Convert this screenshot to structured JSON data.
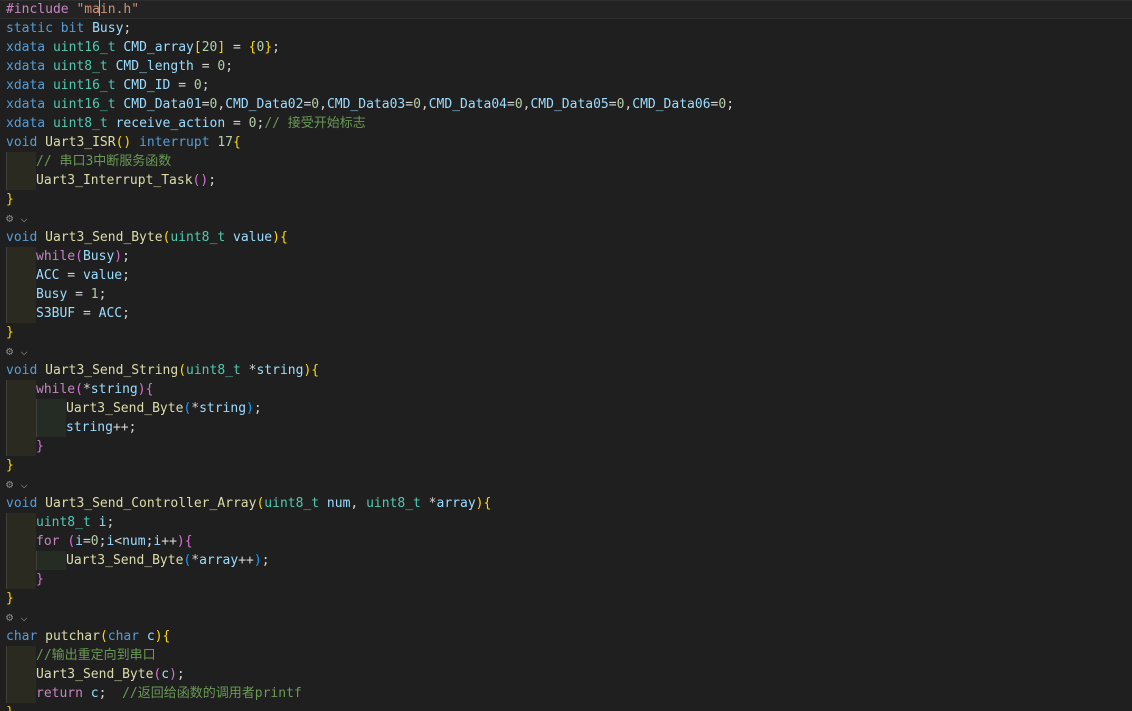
{
  "editor": {
    "codelens_label": "⚙ ⌵",
    "lines": [
      {
        "indent": 0,
        "current": true,
        "tokens": [
          [
            "pp",
            "#include"
          ],
          [
            "pl",
            " "
          ],
          [
            "str",
            "\"ma"
          ],
          [
            "caret",
            ""
          ],
          [
            "str",
            "in.h\""
          ]
        ]
      },
      {
        "indent": 0,
        "tokens": [
          [
            "kw",
            "static"
          ],
          [
            "pl",
            " "
          ],
          [
            "kw",
            "bit"
          ],
          [
            "pl",
            " "
          ],
          [
            "var",
            "Busy"
          ],
          [
            "pl",
            ";"
          ]
        ]
      },
      {
        "indent": 0,
        "tokens": [
          [
            "kw",
            "xdata"
          ],
          [
            "pl",
            " "
          ],
          [
            "ty",
            "uint16_t"
          ],
          [
            "pl",
            " "
          ],
          [
            "var",
            "CMD_array"
          ],
          [
            "b1",
            "["
          ],
          [
            "num",
            "20"
          ],
          [
            "b1",
            "]"
          ],
          [
            "pl",
            " = "
          ],
          [
            "b1",
            "{"
          ],
          [
            "num",
            "0"
          ],
          [
            "b1",
            "}"
          ],
          [
            "pl",
            ";"
          ]
        ]
      },
      {
        "indent": 0,
        "tokens": [
          [
            "kw",
            "xdata"
          ],
          [
            "pl",
            " "
          ],
          [
            "ty",
            "uint8_t"
          ],
          [
            "pl",
            " "
          ],
          [
            "var",
            "CMD_length"
          ],
          [
            "pl",
            " = "
          ],
          [
            "num",
            "0"
          ],
          [
            "pl",
            ";"
          ]
        ]
      },
      {
        "indent": 0,
        "tokens": [
          [
            "kw",
            "xdata"
          ],
          [
            "pl",
            " "
          ],
          [
            "ty",
            "uint16_t"
          ],
          [
            "pl",
            " "
          ],
          [
            "var",
            "CMD_ID"
          ],
          [
            "pl",
            " = "
          ],
          [
            "num",
            "0"
          ],
          [
            "pl",
            ";"
          ]
        ]
      },
      {
        "indent": 0,
        "tokens": [
          [
            "kw",
            "xdata"
          ],
          [
            "pl",
            " "
          ],
          [
            "ty",
            "uint16_t"
          ],
          [
            "pl",
            " "
          ],
          [
            "var",
            "CMD_Data01"
          ],
          [
            "pl",
            "="
          ],
          [
            "num",
            "0"
          ],
          [
            "pl",
            ","
          ],
          [
            "var",
            "CMD_Data02"
          ],
          [
            "pl",
            "="
          ],
          [
            "num",
            "0"
          ],
          [
            "pl",
            ","
          ],
          [
            "var",
            "CMD_Data03"
          ],
          [
            "pl",
            "="
          ],
          [
            "num",
            "0"
          ],
          [
            "pl",
            ","
          ],
          [
            "var",
            "CMD_Data04"
          ],
          [
            "pl",
            "="
          ],
          [
            "num",
            "0"
          ],
          [
            "pl",
            ","
          ],
          [
            "var",
            "CMD_Data05"
          ],
          [
            "pl",
            "="
          ],
          [
            "num",
            "0"
          ],
          [
            "pl",
            ","
          ],
          [
            "var",
            "CMD_Data06"
          ],
          [
            "pl",
            "="
          ],
          [
            "num",
            "0"
          ],
          [
            "pl",
            ";"
          ]
        ]
      },
      {
        "indent": 0,
        "tokens": [
          [
            "kw",
            "xdata"
          ],
          [
            "pl",
            " "
          ],
          [
            "ty",
            "uint8_t"
          ],
          [
            "pl",
            " "
          ],
          [
            "var",
            "receive_action"
          ],
          [
            "pl",
            " = "
          ],
          [
            "num",
            "0"
          ],
          [
            "pl",
            ";"
          ],
          [
            "cm",
            "// 接受开始标志"
          ]
        ]
      },
      {
        "indent": 0,
        "tokens": [
          [
            "kw",
            "void"
          ],
          [
            "pl",
            " "
          ],
          [
            "fn",
            "Uart3_ISR"
          ],
          [
            "b1",
            "()"
          ],
          [
            "pl",
            " "
          ],
          [
            "kw",
            "interrupt"
          ],
          [
            "pl",
            " "
          ],
          [
            "num",
            "17"
          ],
          [
            "b1",
            "{"
          ]
        ]
      },
      {
        "indent": 1,
        "tokens": [
          [
            "cm",
            "// 串口3中断服务函数"
          ]
        ]
      },
      {
        "indent": 1,
        "tokens": [
          [
            "fn",
            "Uart3_Interrupt_Task"
          ],
          [
            "b2",
            "()"
          ],
          [
            "pl",
            ";"
          ]
        ]
      },
      {
        "indent": 0,
        "tokens": [
          [
            "b1",
            "}"
          ]
        ]
      },
      {
        "lens": true
      },
      {
        "indent": 0,
        "tokens": [
          [
            "kw",
            "void"
          ],
          [
            "pl",
            " "
          ],
          [
            "fn",
            "Uart3_Send_Byte"
          ],
          [
            "b1",
            "("
          ],
          [
            "ty",
            "uint8_t"
          ],
          [
            "pl",
            " "
          ],
          [
            "var",
            "value"
          ],
          [
            "b1",
            "){"
          ]
        ]
      },
      {
        "indent": 1,
        "tokens": [
          [
            "pp",
            "while"
          ],
          [
            "b2",
            "("
          ],
          [
            "var",
            "Busy"
          ],
          [
            "b2",
            ")"
          ],
          [
            "pl",
            ";"
          ]
        ]
      },
      {
        "indent": 1,
        "tokens": [
          [
            "var",
            "ACC"
          ],
          [
            "pl",
            " = "
          ],
          [
            "var",
            "value"
          ],
          [
            "pl",
            ";"
          ]
        ]
      },
      {
        "indent": 1,
        "tokens": [
          [
            "var",
            "Busy"
          ],
          [
            "pl",
            " = "
          ],
          [
            "num",
            "1"
          ],
          [
            "pl",
            ";"
          ]
        ]
      },
      {
        "indent": 1,
        "tokens": [
          [
            "var",
            "S3BUF"
          ],
          [
            "pl",
            " = "
          ],
          [
            "var",
            "ACC"
          ],
          [
            "pl",
            ";"
          ]
        ]
      },
      {
        "indent": 0,
        "tokens": [
          [
            "b1",
            "}"
          ]
        ]
      },
      {
        "lens": true
      },
      {
        "indent": 0,
        "tokens": [
          [
            "kw",
            "void"
          ],
          [
            "pl",
            " "
          ],
          [
            "fn",
            "Uart3_Send_String"
          ],
          [
            "b1",
            "("
          ],
          [
            "ty",
            "uint8_t"
          ],
          [
            "pl",
            " *"
          ],
          [
            "var",
            "string"
          ],
          [
            "b1",
            "){"
          ]
        ]
      },
      {
        "indent": 1,
        "tokens": [
          [
            "pp",
            "while"
          ],
          [
            "b2",
            "("
          ],
          [
            "pl",
            "*"
          ],
          [
            "var",
            "string"
          ],
          [
            "b2",
            ")"
          ],
          [
            "b2",
            "{"
          ]
        ]
      },
      {
        "indent": 2,
        "tokens": [
          [
            "fn",
            "Uart3_Send_Byte"
          ],
          [
            "b3",
            "("
          ],
          [
            "pl",
            "*"
          ],
          [
            "var",
            "string"
          ],
          [
            "b3",
            ")"
          ],
          [
            "pl",
            ";"
          ]
        ]
      },
      {
        "indent": 2,
        "tokens": [
          [
            "var",
            "string"
          ],
          [
            "pl",
            "++;"
          ]
        ]
      },
      {
        "indent": 1,
        "tokens": [
          [
            "b2",
            "}"
          ]
        ]
      },
      {
        "indent": 0,
        "tokens": [
          [
            "b1",
            "}"
          ]
        ]
      },
      {
        "lens": true
      },
      {
        "indent": 0,
        "tokens": [
          [
            "kw",
            "void"
          ],
          [
            "pl",
            " "
          ],
          [
            "fn",
            "Uart3_Send_Controller_Array"
          ],
          [
            "b1",
            "("
          ],
          [
            "ty",
            "uint8_t"
          ],
          [
            "pl",
            " "
          ],
          [
            "var",
            "num"
          ],
          [
            "pl",
            ", "
          ],
          [
            "ty",
            "uint8_t"
          ],
          [
            "pl",
            " *"
          ],
          [
            "var",
            "array"
          ],
          [
            "b1",
            "){"
          ]
        ]
      },
      {
        "indent": 1,
        "tokens": [
          [
            "ty",
            "uint8_t"
          ],
          [
            "pl",
            " "
          ],
          [
            "var",
            "i"
          ],
          [
            "pl",
            ";"
          ]
        ]
      },
      {
        "indent": 1,
        "tokens": [
          [
            "pp",
            "for"
          ],
          [
            "pl",
            " "
          ],
          [
            "b2",
            "("
          ],
          [
            "var",
            "i"
          ],
          [
            "pl",
            "="
          ],
          [
            "num",
            "0"
          ],
          [
            "pl",
            ";"
          ],
          [
            "var",
            "i"
          ],
          [
            "pl",
            "<"
          ],
          [
            "var",
            "num"
          ],
          [
            "pl",
            ";"
          ],
          [
            "var",
            "i"
          ],
          [
            "pl",
            "++"
          ],
          [
            "b2",
            ")"
          ],
          [
            "b2",
            "{"
          ]
        ]
      },
      {
        "indent": 2,
        "tokens": [
          [
            "fn",
            "Uart3_Send_Byte"
          ],
          [
            "b3",
            "("
          ],
          [
            "pl",
            "*"
          ],
          [
            "var",
            "array"
          ],
          [
            "pl",
            "++"
          ],
          [
            "b3",
            ")"
          ],
          [
            "pl",
            ";"
          ]
        ]
      },
      {
        "indent": 1,
        "tokens": [
          [
            "b2",
            "}"
          ]
        ]
      },
      {
        "indent": 0,
        "tokens": [
          [
            "b1",
            "}"
          ]
        ]
      },
      {
        "lens": true
      },
      {
        "indent": 0,
        "tokens": [
          [
            "kw",
            "char"
          ],
          [
            "pl",
            " "
          ],
          [
            "fn",
            "putchar"
          ],
          [
            "b1",
            "("
          ],
          [
            "kw",
            "char"
          ],
          [
            "pl",
            " "
          ],
          [
            "var",
            "c"
          ],
          [
            "b1",
            "){"
          ]
        ]
      },
      {
        "indent": 1,
        "tokens": [
          [
            "cm",
            "//输出重定向到串口"
          ]
        ]
      },
      {
        "indent": 1,
        "tokens": [
          [
            "fn",
            "Uart3_Send_Byte"
          ],
          [
            "b2",
            "("
          ],
          [
            "var",
            "c"
          ],
          [
            "b2",
            ")"
          ],
          [
            "pl",
            ";"
          ]
        ]
      },
      {
        "indent": 1,
        "tokens": [
          [
            "pp",
            "return"
          ],
          [
            "pl",
            " "
          ],
          [
            "var",
            "c"
          ],
          [
            "pl",
            ";  "
          ],
          [
            "cm",
            "//返回给函数的调用者printf"
          ]
        ]
      },
      {
        "indent": 0,
        "tokens": [
          [
            "b1",
            "}"
          ]
        ]
      }
    ]
  }
}
